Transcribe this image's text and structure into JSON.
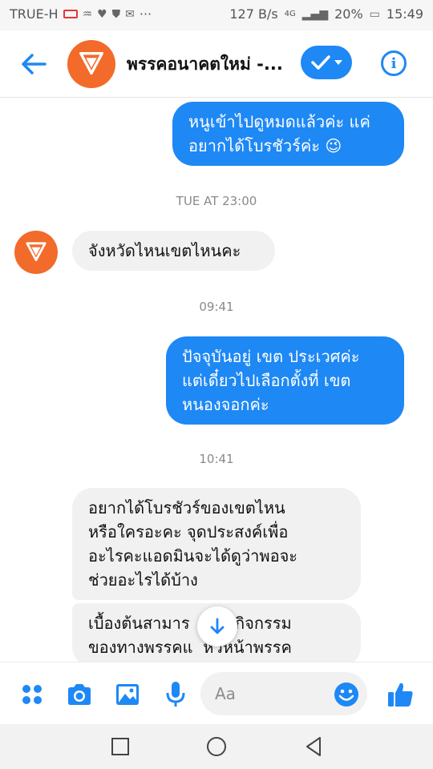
{
  "status_bar": {
    "carrier": "TRUE-H",
    "dots": "···",
    "net_speed": "127 B/s",
    "network": "4G",
    "battery": "20%",
    "time": "15:49"
  },
  "header": {
    "title": "พรรคอนาคตใหม่ -...",
    "avatar_caption": "พรรคอนาคตใหม่"
  },
  "messages": [
    {
      "type": "out",
      "text_lines": [
        "หนูเข้าไปดูหมดแล้วค่ะ แค่",
        "อยากได้โบรชัวร์ค่ะ 😉"
      ]
    },
    {
      "type": "timestamp",
      "text": "TUE AT 23:00"
    },
    {
      "type": "in",
      "text_lines": [
        "จังหวัดไหนเขตไหนคะ"
      ]
    },
    {
      "type": "timestamp",
      "text": "09:41"
    },
    {
      "type": "out",
      "text_lines": [
        "ปัจจุบันอยู่ เขต ประเวศค่ะ",
        "แต่เดี๋ยวไปเลือกตั้งที่ เขต",
        "หนองจอกค่ะ"
      ]
    },
    {
      "type": "timestamp",
      "text": "10:41"
    },
    {
      "type": "in",
      "text_lines": [
        "อยากได้โบรชัวร์ของเขตไหน",
        "หรือใครอะคะ จุดประสงค์เพื่อ",
        "อะไรคะแอดมินจะได้ดูว่าพอจะ",
        "ช่วยอะไรได้บ้าง"
      ]
    },
    {
      "type": "in",
      "text_lines": [
        "เบื้องต้นสามาร   ตามกิจกรรม",
        "ของทางพรรคแ  หัวหน้าพรรค"
      ]
    }
  ],
  "composer": {
    "placeholder": "Aa"
  },
  "colors": {
    "accent": "#1e88f5",
    "brand": "#f26b2b",
    "incoming_bubble": "#f1f1f1"
  },
  "icons": [
    "back-arrow-icon",
    "checkmark-icon",
    "chevron-down-icon",
    "info-icon",
    "apps-grid-icon",
    "camera-icon",
    "gallery-icon",
    "microphone-icon",
    "emoji-icon",
    "thumbs-up-icon",
    "arrow-down-icon",
    "square-icon",
    "circle-icon",
    "triangle-back-icon"
  ]
}
